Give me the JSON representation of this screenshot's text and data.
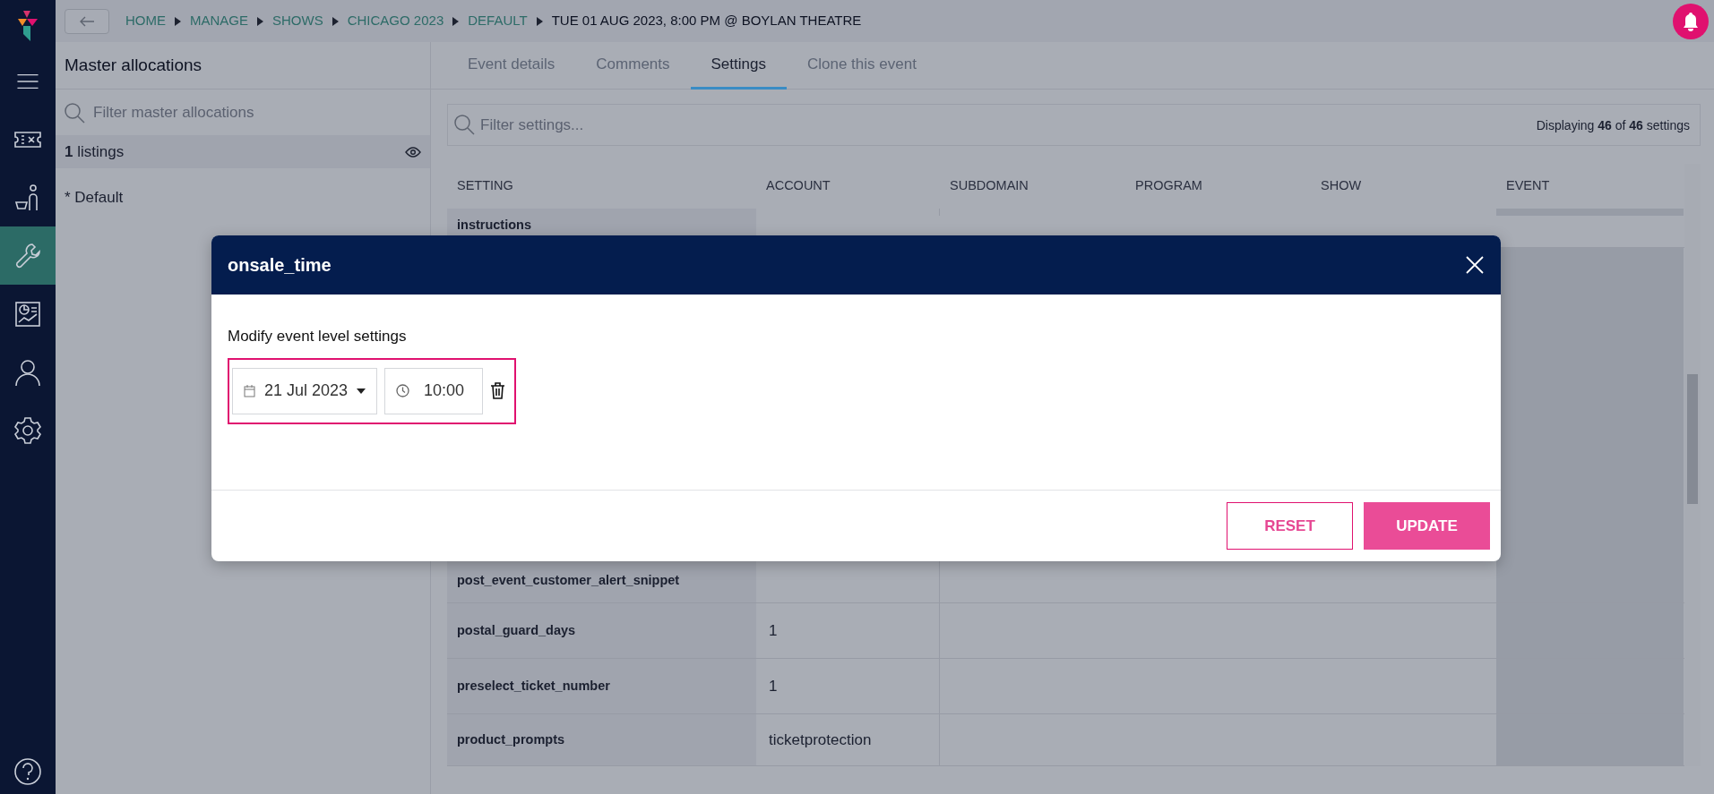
{
  "sidebar": {
    "items": [
      {
        "kind": "ticket",
        "selected": false
      },
      {
        "kind": "customer",
        "selected": false
      },
      {
        "kind": "wrench",
        "selected": true
      },
      {
        "kind": "report",
        "selected": false
      },
      {
        "kind": "person",
        "selected": false
      },
      {
        "kind": "gear",
        "selected": false
      }
    ]
  },
  "breadcrumb": [
    {
      "label": "HOME",
      "current": false
    },
    {
      "label": "MANAGE",
      "current": false
    },
    {
      "label": "SHOWS",
      "current": false
    },
    {
      "label": "CHICAGO 2023",
      "current": false
    },
    {
      "label": "DEFAULT",
      "current": false
    },
    {
      "label": "TUE 01 AUG 2023, 8:00 PM @ BOYLAN THEATRE",
      "current": true
    }
  ],
  "left_panel": {
    "title": "Master allocations",
    "search": {
      "placeholder": "Filter master allocations"
    },
    "summary": "**1** listings",
    "items": [
      "* Default"
    ]
  },
  "tabs": [
    {
      "label": "Event details",
      "selected": false
    },
    {
      "label": "Comments",
      "selected": false
    },
    {
      "label": "Settings",
      "selected": true
    },
    {
      "label": "Clone this event",
      "selected": false
    }
  ],
  "settings_filter": {
    "placeholder": "Filter settings...",
    "count": "Displaying **46** of **46** settings"
  },
  "table": {
    "columns": [
      "SETTING",
      "ACCOUNT",
      "SUBDOMAIN",
      "PROGRAM",
      "SHOW",
      "EVENT"
    ],
    "rows_top": [
      {
        "setting": "instructions"
      }
    ],
    "rows_bottom": [
      {
        "setting": "post_event_customer_alert_snippet"
      },
      {
        "setting": "postal_guard_days",
        "account": "1"
      },
      {
        "setting": "preselect_ticket_number",
        "account": "1"
      },
      {
        "setting": "product_prompts",
        "account": "ticketprotection"
      }
    ]
  },
  "modal": {
    "title": "onsale_time",
    "label": "Modify event level settings",
    "date": "21 Jul 2023",
    "time": "10:00",
    "buttons": [
      {
        "label": "RESET",
        "kind": "outline"
      },
      {
        "label": "UPDATE",
        "kind": "primary"
      }
    ]
  }
}
